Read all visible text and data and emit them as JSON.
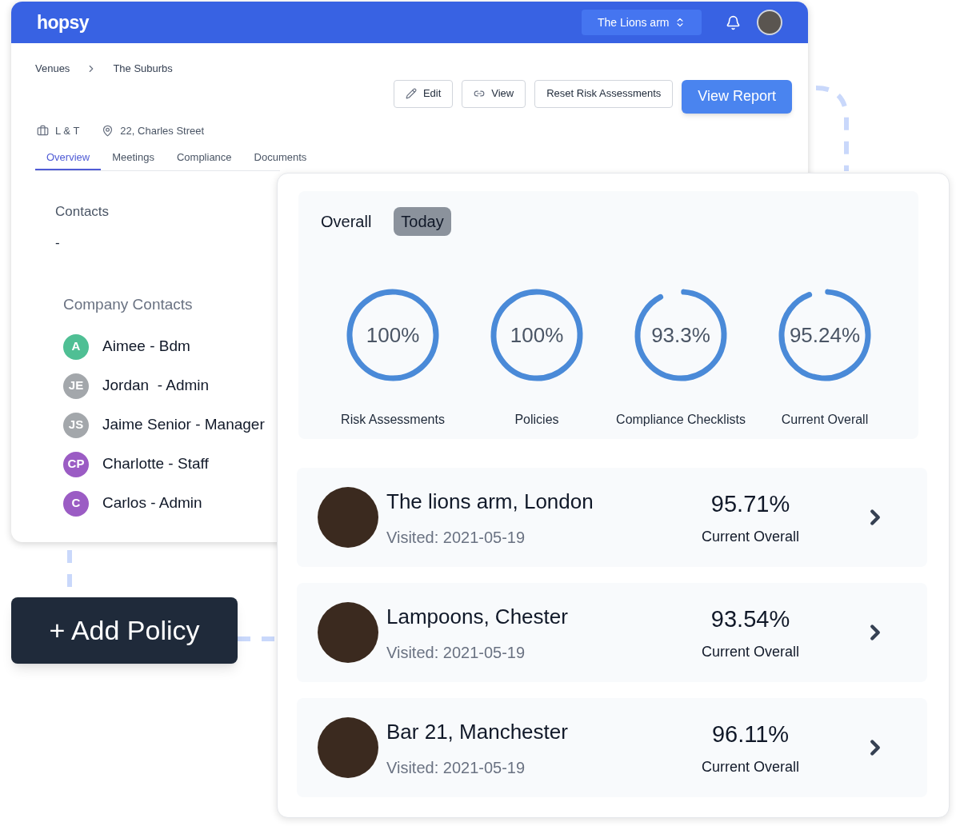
{
  "header": {
    "logo": "hopsy",
    "venue_select": "The Lions arm"
  },
  "breadcrumb": [
    "Venues",
    "The Suburbs"
  ],
  "actions": [
    {
      "label": "Edit",
      "kind": "edit"
    },
    {
      "label": "View",
      "kind": "link"
    },
    {
      "label": "Reset Risk Assessments",
      "kind": "plain"
    },
    {
      "label": "View Report",
      "kind": "primary"
    }
  ],
  "meta": [
    {
      "kind": "company",
      "text": "L & T"
    },
    {
      "kind": "location",
      "text": "22, Charles Street"
    }
  ],
  "tabs": [
    {
      "label": "Overview",
      "selected": true
    },
    {
      "label": "Meetings",
      "selected": false
    },
    {
      "label": "Compliance",
      "selected": false
    },
    {
      "label": "Documents",
      "selected": false
    }
  ],
  "contacts": {
    "title": "Contacts",
    "value": "-"
  },
  "company_contacts": {
    "title": "Company Contacts",
    "items": [
      {
        "initials": "A",
        "name": "Aimee - Bdm",
        "color": "#4fbf94"
      },
      {
        "initials": "JE",
        "name": "Jordan  - Admin",
        "color": "#a3a7ab"
      },
      {
        "initials": "JS",
        "name": "Jaime Senior - Manager",
        "color": "#a3a7ab"
      },
      {
        "initials": "CP",
        "name": "Charlotte - Staff",
        "color": "#9b5cc4"
      },
      {
        "initials": "C",
        "name": "Carlos - Admin",
        "color": "#9b5cc4"
      }
    ]
  },
  "stats": {
    "toggle": [
      {
        "label": "Overall",
        "selected": false
      },
      {
        "label": "Today",
        "selected": true
      }
    ],
    "rings": [
      {
        "value": "100%",
        "label": "Risk Assessments",
        "level": 1
      },
      {
        "value": "100%",
        "label": "Policies",
        "level": 1
      },
      {
        "value": "93.3%",
        "label": "Compliance Checklists",
        "level": 0.933
      },
      {
        "value": "95.24%",
        "label": "Current Overall",
        "level": 0.9524
      }
    ]
  },
  "venues": [
    {
      "name": "The lions arm, London",
      "visited": "Visited: 2021-05-19",
      "score": "95.71%",
      "score_label": "Current Overall"
    },
    {
      "name": "Lampoons, Chester",
      "visited": "Visited: 2021-05-19",
      "score": "93.54%",
      "score_label": "Current Overall"
    },
    {
      "name": "Bar 21, Manchester",
      "visited": "Visited: 2021-05-19",
      "score": "96.11%",
      "score_label": "Current Overall"
    }
  ],
  "add_policy": "+ Add Policy"
}
